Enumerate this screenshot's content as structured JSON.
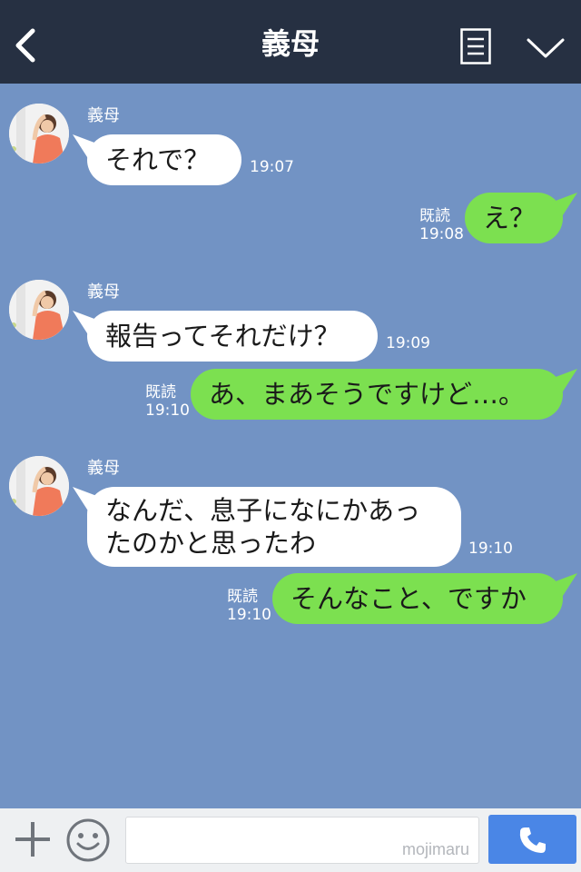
{
  "header": {
    "title": "義母"
  },
  "messages": [
    {
      "sender": "義母",
      "text": "それで？",
      "time": "19:07"
    },
    {
      "read": "既読",
      "time": "19:08",
      "text": "え？"
    },
    {
      "sender": "義母",
      "text": "報告ってそれだけ？",
      "time": "19:09"
    },
    {
      "read": "既読",
      "time": "19:10",
      "text": "あ、まあそうですけど…。"
    },
    {
      "sender": "義母",
      "text_line1": "なんだ、息子になにかあっ",
      "text_line2": "たのかと思ったわ",
      "time": "19:10"
    },
    {
      "read": "既読",
      "time": "19:10",
      "text": "そんなこと、ですか"
    }
  ],
  "input": {
    "watermark": "mojimaru"
  },
  "colors": {
    "header_bg": "#263042",
    "chat_bg": "#7293c4",
    "outgoing_bubble": "#7ce050",
    "incoming_bubble": "#ffffff",
    "call_button": "#4a86e6"
  }
}
